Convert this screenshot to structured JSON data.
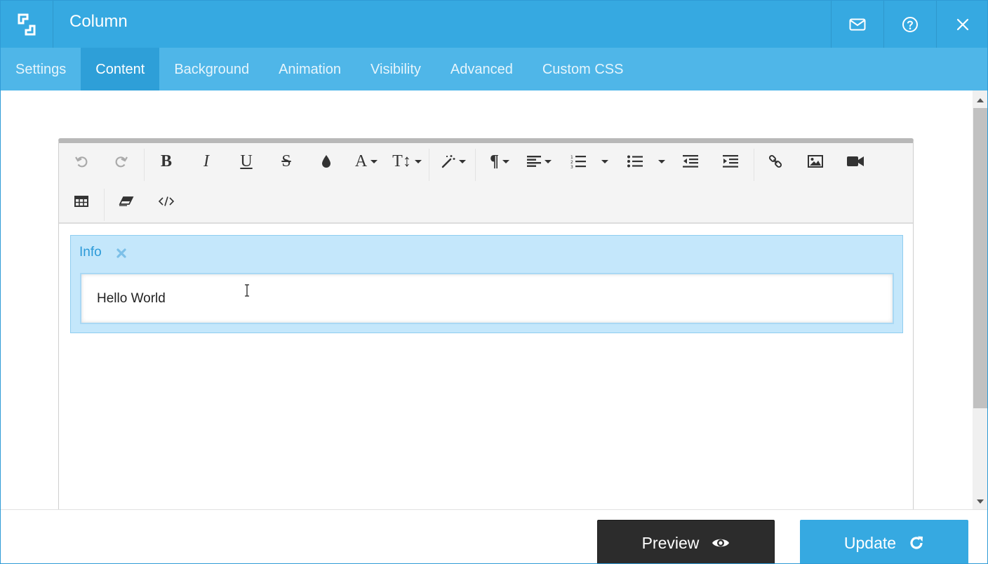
{
  "window": {
    "title": "Column"
  },
  "tabs": [
    {
      "label": "Settings",
      "active": false
    },
    {
      "label": "Content",
      "active": true
    },
    {
      "label": "Background",
      "active": false
    },
    {
      "label": "Animation",
      "active": false
    },
    {
      "label": "Visibility",
      "active": false
    },
    {
      "label": "Advanced",
      "active": false
    },
    {
      "label": "Custom CSS",
      "active": false
    }
  ],
  "toolbar": {
    "bold_glyph": "B",
    "italic_glyph": "I",
    "underline_glyph": "U",
    "strike_glyph": "S",
    "font_glyph": "A",
    "size_glyph": "T↕",
    "paragraph_glyph": "¶"
  },
  "editor": {
    "block_label": "Info",
    "block_text": "Hello World"
  },
  "footer": {
    "preview_label": "Preview",
    "update_label": "Update"
  },
  "colors": {
    "header": "#36a9e1",
    "tabs": "#4fb6e8",
    "active_tab": "#2e9fd8",
    "info_bg": "#c4e7fb",
    "preview_bg": "#2c2c2c",
    "update_bg": "#36a9e1"
  },
  "icons": {
    "logo": "bracket-logo-icon",
    "mail": "envelope-icon",
    "help": "question-circle-icon",
    "close": "close-icon"
  }
}
